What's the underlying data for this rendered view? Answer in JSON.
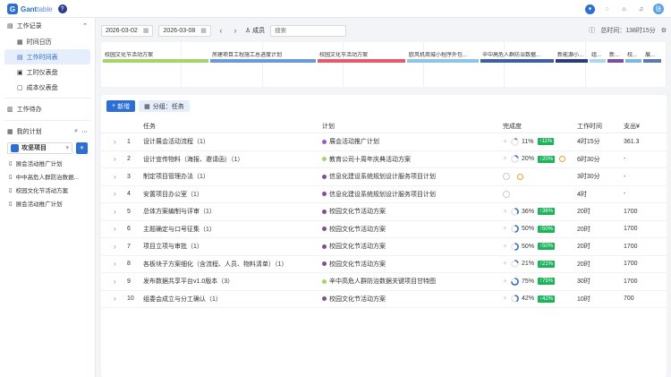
{
  "app": {
    "logo_letter": "G",
    "logo_name": "Gant",
    "logo_name_light": "table",
    "help": "?",
    "user_initial": "张"
  },
  "colors": {
    "brand": "#2b6fd6",
    "success": "#1db35a",
    "warn": "#f0a020"
  },
  "sidebar": {
    "section_work_log": "工作记录",
    "items": [
      {
        "label": "时间日历",
        "icon": "calendar-icon"
      },
      {
        "label": "工作时间表",
        "icon": "timesheet-icon",
        "active": true
      },
      {
        "label": "工时仪表盘",
        "icon": "dashboard-icon"
      },
      {
        "label": "成本仪表盘",
        "icon": "cost-icon"
      }
    ],
    "section_todo": "工作待办",
    "section_my_plans": "我的计划",
    "project_select": "攻坚项目",
    "plans": [
      "展会活动推广计划",
      "中中高危人群防治数据...",
      "校园文化节活动方案",
      "展会活动推广计划"
    ]
  },
  "filter": {
    "date_start": "2026-03-02",
    "date_end": "2026-03-08",
    "member_label": "成员",
    "search_placeholder": "搜索",
    "total_time": "总时间：138时15分"
  },
  "timeline": [
    {
      "label": "校园文化节活动方案",
      "color": "#a6d36a"
    },
    {
      "label": "房建项目工程施工总进度计划",
      "color": "#6a9ad8"
    },
    {
      "label": "校园文化节活动方案",
      "color": "#e65a6a"
    },
    {
      "label": "欧风机商城小程序外包...",
      "color": "#8fc4e6"
    },
    {
      "label": "辛中高危人群防治数据...",
      "color": "#3f5fa0"
    },
    {
      "label": "新能源小...",
      "color": "#2b3c7c"
    },
    {
      "label": "组...",
      "color": "#a8d8f0"
    },
    {
      "label": "新...",
      "color": "#7b4ea0"
    },
    {
      "label": "校...",
      "color": "#7bb8e0"
    },
    {
      "label": "展...",
      "color": "#5a7ab0"
    }
  ],
  "toolbar": {
    "new_label": "新增",
    "group_label": "分组：任务"
  },
  "table": {
    "headers": {
      "task": "任务",
      "plan": "计划",
      "progress": "完成度",
      "work_time": "工作时间",
      "cost": "支出¥"
    },
    "rows": [
      {
        "no": "1",
        "task": "设计展会活动流程（1）",
        "plan": "展会活动推广计划",
        "plan_color": "#9b59d0",
        "progress": "11%",
        "pct": 0.11,
        "badge": "↑11%",
        "time": "4时15分",
        "cost": "361.3"
      },
      {
        "no": "2",
        "task": "设计宣传物料（海报、邀请函）（1）",
        "plan": "教育公司十周年庆典活动方案",
        "plan_color": "#a6d36a",
        "progress": "20%",
        "pct": 0.2,
        "badge": "↑20%",
        "clock": true,
        "time": "6时30分",
        "cost": "-"
      },
      {
        "no": "3",
        "task": "制定项目管理办法（1）",
        "plan": "信息化建设系统规划设计服务项目计划",
        "plan_color": "#7b4ea0",
        "progress": "",
        "pct": 0,
        "clock": true,
        "time": "3时30分",
        "cost": "-"
      },
      {
        "no": "4",
        "task": "安置项目办公室（1）",
        "plan": "信息化建设系统规划设计服务项目计划",
        "plan_color": "#7b4ea0",
        "progress": "",
        "pct": 0,
        "time": "4时",
        "cost": "-"
      },
      {
        "no": "5",
        "task": "总体方案编制与评审（1）",
        "plan": "校园文化节活动方案",
        "plan_color": "#7b4ea0",
        "progress": "36%",
        "pct": 0.36,
        "badge": "↑36%",
        "time": "20时",
        "cost": "1700"
      },
      {
        "no": "6",
        "task": "主题确定与口号征集（1）",
        "plan": "校园文化节活动方案",
        "plan_color": "#7b4ea0",
        "progress": "50%",
        "pct": 0.5,
        "badge": "↑50%",
        "time": "20时",
        "cost": "1700"
      },
      {
        "no": "7",
        "task": "项目立项与审批（1）",
        "plan": "校园文化节活动方案",
        "plan_color": "#7b4ea0",
        "progress": "50%",
        "pct": 0.5,
        "badge": "↑50%",
        "time": "20时",
        "cost": "1700"
      },
      {
        "no": "8",
        "task": "各板块子方案细化（含流程、人员、物料清单）（1）",
        "plan": "校园文化节活动方案",
        "plan_color": "#7b4ea0",
        "progress": "21%",
        "pct": 0.21,
        "badge": "↑21%",
        "time": "20时",
        "cost": "1700"
      },
      {
        "no": "9",
        "task": "发布数据共享平台v1.0版本（3）",
        "plan": "辛中高危人群防治数据关键项目甘特图",
        "plan_color": "#a6d36a",
        "progress": "75%",
        "pct": 0.75,
        "badge": "↑75%",
        "time": "30时",
        "cost": "1700"
      },
      {
        "no": "10",
        "task": "组委会成立与分工确认（1）",
        "plan": "校园文化节活动方案",
        "plan_color": "#7b4ea0",
        "progress": "42%",
        "pct": 0.42,
        "badge": "↑42%",
        "time": "10时",
        "cost": "700"
      }
    ]
  }
}
